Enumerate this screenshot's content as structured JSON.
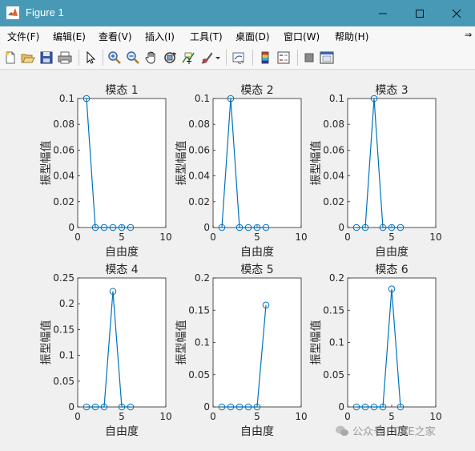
{
  "window": {
    "title": "Figure 1"
  },
  "menu": [
    "文件(F)",
    "编辑(E)",
    "查看(V)",
    "插入(I)",
    "工具(T)",
    "桌面(D)",
    "窗口(W)",
    "帮助(H)"
  ],
  "menu_overflow": "⇒",
  "toolbar_icons": [
    "new-figure-icon",
    "open-file-icon",
    "save-icon",
    "print-icon",
    "pointer-icon",
    "zoom-in-icon",
    "zoom-out-icon",
    "pan-icon",
    "rotate-3d-icon",
    "data-cursor-icon",
    "brush-icon",
    "link-plot-icon",
    "colorbar-icon",
    "legend-icon",
    "hide-plot-tools-icon",
    "show-plot-tools-icon"
  ],
  "watermark": "公众号 · CAE之家",
  "chart_data": [
    {
      "type": "line",
      "title": "模态 1",
      "xlabel": "自由度",
      "ylabel": "振型幅值",
      "x": [
        1,
        2,
        3,
        4,
        5,
        6
      ],
      "y": [
        0.1,
        0,
        0,
        0,
        0,
        0
      ],
      "xlim": [
        0,
        10
      ],
      "ylim": [
        0,
        0.1
      ],
      "xticks": [
        "0",
        "5",
        "10"
      ],
      "yticks": [
        "0",
        "0.02",
        "0.04",
        "0.06",
        "0.08",
        "0.1"
      ],
      "marker": "circle",
      "color": "#0072bd"
    },
    {
      "type": "line",
      "title": "模态 2",
      "xlabel": "自由度",
      "ylabel": "振型幅值",
      "x": [
        1,
        2,
        3,
        4,
        5,
        6
      ],
      "y": [
        0,
        0.1,
        0,
        0,
        0,
        0
      ],
      "xlim": [
        0,
        10
      ],
      "ylim": [
        0,
        0.1
      ],
      "xticks": [
        "0",
        "5",
        "10"
      ],
      "yticks": [
        "0",
        "0.02",
        "0.04",
        "0.06",
        "0.08",
        "0.1"
      ],
      "marker": "circle",
      "color": "#0072bd"
    },
    {
      "type": "line",
      "title": "模态 3",
      "xlabel": "自由度",
      "ylabel": "振型幅值",
      "x": [
        1,
        2,
        3,
        4,
        5,
        6
      ],
      "y": [
        0,
        0,
        0.1,
        0,
        0,
        0
      ],
      "xlim": [
        0,
        10
      ],
      "ylim": [
        0,
        0.1
      ],
      "xticks": [
        "0",
        "5",
        "10"
      ],
      "yticks": [
        "0",
        "0.02",
        "0.04",
        "0.06",
        "0.08",
        "0.1"
      ],
      "marker": "circle",
      "color": "#0072bd"
    },
    {
      "type": "line",
      "title": "模态 4",
      "xlabel": "自由度",
      "ylabel": "振型幅值",
      "x": [
        1,
        2,
        3,
        4,
        5,
        6
      ],
      "y": [
        0,
        0,
        0,
        0.224,
        0,
        0
      ],
      "xlim": [
        0,
        10
      ],
      "ylim": [
        0,
        0.25
      ],
      "xticks": [
        "0",
        "5",
        "10"
      ],
      "yticks": [
        "0",
        "0.05",
        "0.1",
        "0.15",
        "0.2",
        "0.25"
      ],
      "marker": "circle",
      "color": "#0072bd"
    },
    {
      "type": "line",
      "title": "模态 5",
      "xlabel": "自由度",
      "ylabel": "振型幅值",
      "x": [
        1,
        2,
        3,
        4,
        5,
        6
      ],
      "y": [
        0,
        0,
        0,
        0,
        0,
        0.158
      ],
      "xlim": [
        0,
        10
      ],
      "ylim": [
        0,
        0.2
      ],
      "xticks": [
        "0",
        "5",
        "10"
      ],
      "yticks": [
        "0",
        "0.05",
        "0.1",
        "0.15",
        "0.2"
      ],
      "marker": "circle",
      "color": "#0072bd"
    },
    {
      "type": "line",
      "title": "模态 6",
      "xlabel": "自由度",
      "ylabel": "振型幅值",
      "x": [
        1,
        2,
        3,
        4,
        5,
        6
      ],
      "y": [
        0,
        0,
        0,
        0,
        0.183,
        0
      ],
      "xlim": [
        0,
        10
      ],
      "ylim": [
        0,
        0.2
      ],
      "xticks": [
        "0",
        "5",
        "10"
      ],
      "yticks": [
        "0",
        "0.05",
        "0.1",
        "0.15",
        "0.2"
      ],
      "marker": "circle",
      "color": "#0072bd"
    }
  ]
}
